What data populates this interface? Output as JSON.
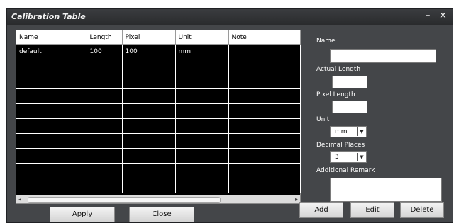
{
  "window": {
    "title": "Calibration Table",
    "minimize_glyph": "–",
    "close_glyph": "✕"
  },
  "table": {
    "columns": [
      "Name",
      "Length",
      "Pixel",
      "Unit",
      "Note"
    ],
    "rows": [
      [
        "default",
        "100",
        "100",
        "mm",
        ""
      ],
      [
        "",
        "",
        "",
        "",
        ""
      ],
      [
        "",
        "",
        "",
        "",
        ""
      ],
      [
        "",
        "",
        "",
        "",
        ""
      ],
      [
        "",
        "",
        "",
        "",
        ""
      ],
      [
        "",
        "",
        "",
        "",
        ""
      ],
      [
        "",
        "",
        "",
        "",
        ""
      ],
      [
        "",
        "",
        "",
        "",
        ""
      ],
      [
        "",
        "",
        "",
        "",
        ""
      ],
      [
        "",
        "",
        "",
        "",
        ""
      ]
    ]
  },
  "scrollbar": {
    "left_arrow": "◂",
    "right_arrow": "▸"
  },
  "form": {
    "name_label": "Name",
    "name_value": "",
    "actual_length_label": "Actual Length",
    "actual_length_value": "",
    "pixel_length_label": "Pixel Length",
    "pixel_length_value": "",
    "unit_label": "Unit",
    "unit_value": "mm",
    "decimal_label": "Decimal Places",
    "decimal_value": "3",
    "remark_label": "Additional Remark",
    "remark_value": ""
  },
  "buttons": {
    "apply": "Apply",
    "close": "Close",
    "add": "Add",
    "edit": "Edit",
    "delete": "Delete"
  },
  "icons": {
    "dropdown": "dropdown-arrow-icon"
  },
  "colors": {
    "panel": "#444649",
    "titlebar": "#2f3032",
    "grid": "#000000"
  }
}
